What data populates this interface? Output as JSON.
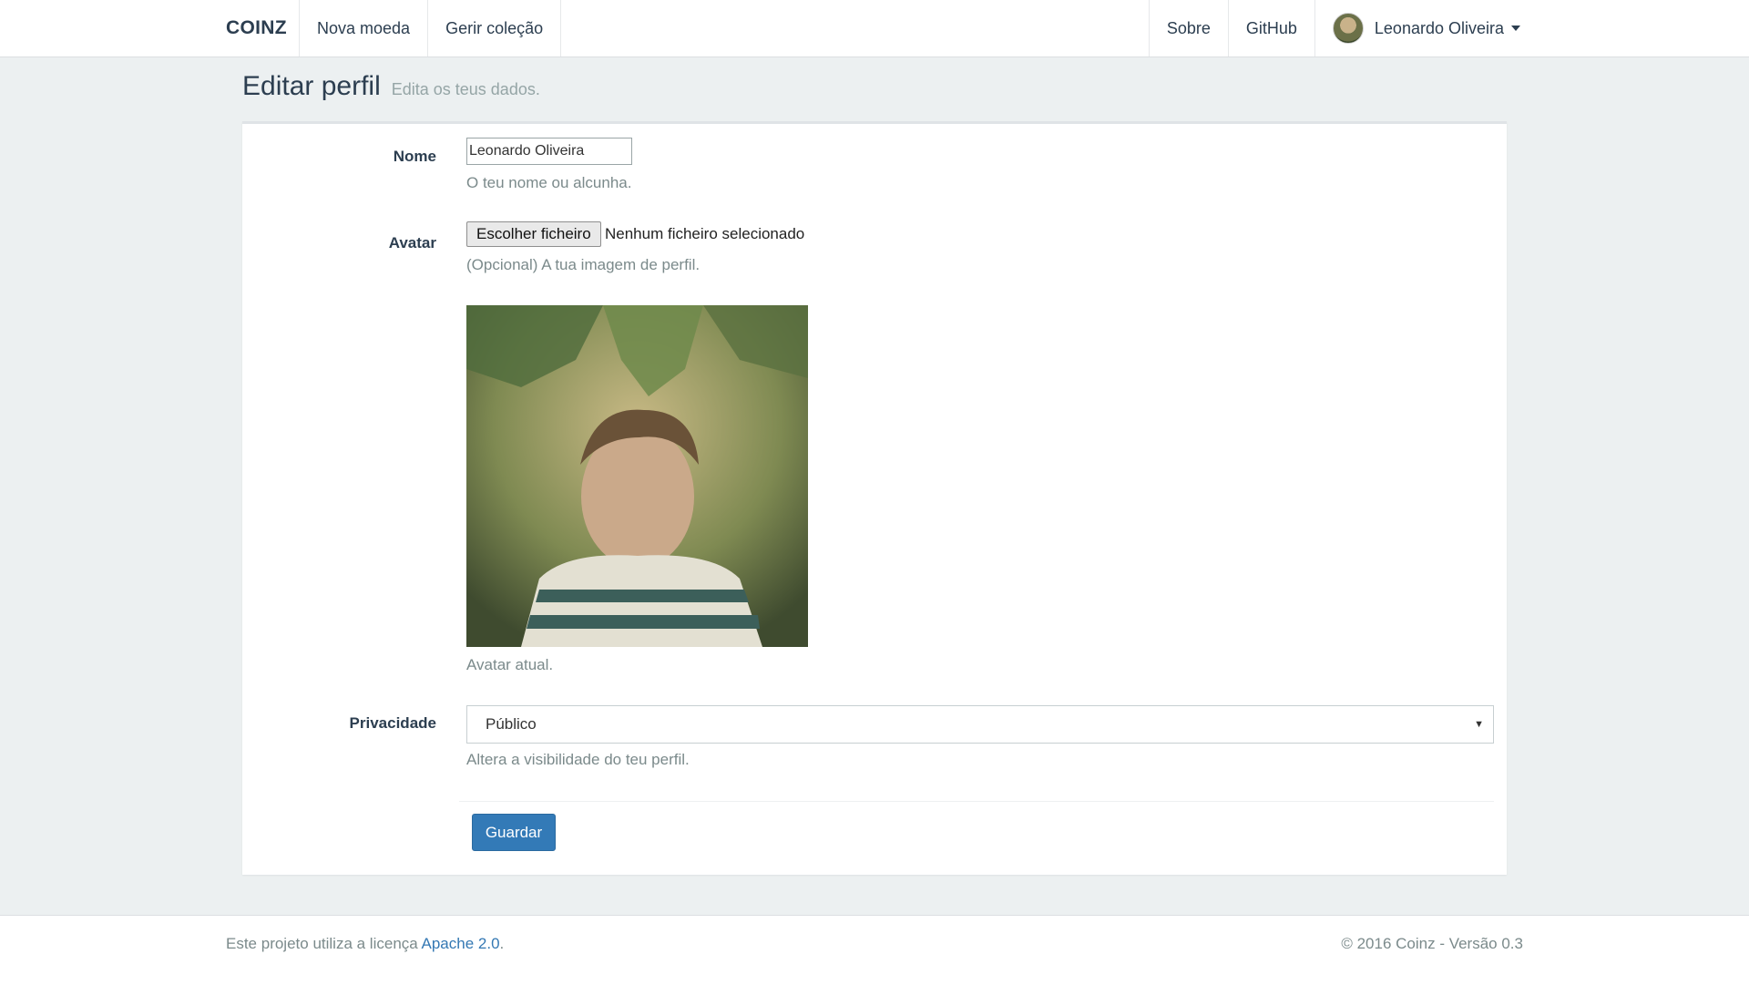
{
  "navbar": {
    "brand": "COINZ",
    "left_items": [
      "Nova moeda",
      "Gerir coleção"
    ],
    "right_items": [
      "Sobre",
      "GitHub"
    ],
    "user_name": "Leonardo Oliveira"
  },
  "header": {
    "title": "Editar perfil",
    "subtitle": "Edita os teus dados."
  },
  "form": {
    "name_label": "Nome",
    "name_value": "Leonardo Oliveira",
    "name_help": "O teu nome ou alcunha.",
    "avatar_label": "Avatar",
    "file_button": "Escolher ficheiro",
    "file_status": "Nenhum ficheiro selecionado",
    "avatar_help": "(Opcional) A tua imagem de perfil.",
    "current_avatar_caption": "Avatar atual.",
    "privacy_label": "Privacidade",
    "privacy_selected": "Público",
    "privacy_help": "Altera a visibilidade do teu perfil.",
    "save_button": "Guardar"
  },
  "footer": {
    "license_prefix": "Este projeto utiliza a licença ",
    "license_link": "Apache 2.0",
    "license_suffix": ".",
    "copyright": "© 2016 Coinz - Versão 0.3"
  },
  "colors": {
    "navy": "#2c3e50",
    "muted": "#7b8a8b",
    "primary": "#337ab7",
    "background": "#ecf0f1"
  }
}
